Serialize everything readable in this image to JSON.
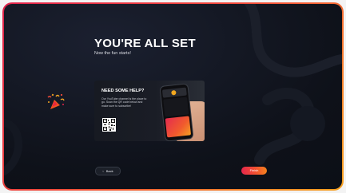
{
  "heading": {
    "title": "YOU'RE ALL SET",
    "subtitle": "Now the fun starts!"
  },
  "help": {
    "title": "NEED SOME HELP?",
    "body": "Our YouTube channel is the place to go. Scan the QR code below and make sure to subscribe!"
  },
  "buttons": {
    "back_label": "Back",
    "back_icon": "chevron-left-icon",
    "finish_label": "Finish"
  },
  "icons": {
    "celebration": "party-popper-icon",
    "qr": "qr-code-icon"
  },
  "colors": {
    "accent_red": "#e5264c",
    "accent_orange": "#f4831e",
    "background": "#0e1119"
  }
}
